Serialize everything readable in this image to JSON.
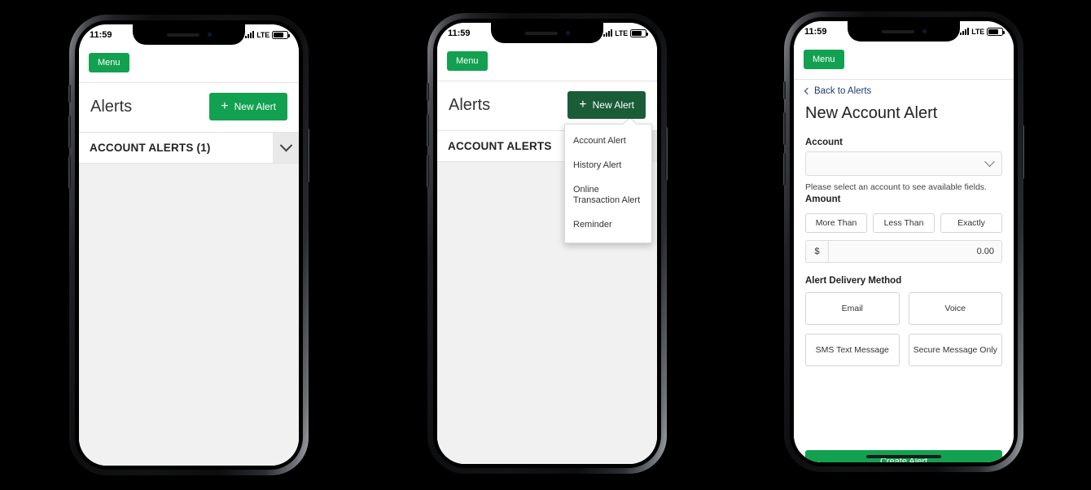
{
  "theme": {
    "page_background": "#000000",
    "brand_green": "#12a150",
    "brand_green_active": "#1a5c38",
    "link_navy": "#1f3a6e",
    "screen_gray": "#f1f1f1"
  },
  "status_bar": {
    "time": "11:59",
    "network": "LTE",
    "signal_icon": "signal-bars-icon",
    "battery_icon": "battery-icon"
  },
  "phones": [
    {
      "id": "phone-1",
      "name": "alerts-list-screen",
      "menu_label": "Menu",
      "page_title": "Alerts",
      "new_alert_label": "New Alert",
      "new_alert_state": "default",
      "section_title": "ACCOUNT ALERTS (1)",
      "collapse_icon": "chevron-down-icon",
      "dropdown_open": false,
      "home_indicator": false
    },
    {
      "id": "phone-2",
      "name": "alerts-list-with-dropdown-screen",
      "menu_label": "Menu",
      "page_title": "Alerts",
      "new_alert_label": "New Alert",
      "new_alert_state": "active",
      "section_title": "ACCOUNT ALERTS",
      "collapse_icon": "chevron-down-icon",
      "dropdown_open": true,
      "dropdown_items": [
        "Account Alert",
        "History Alert",
        "Online Transaction Alert",
        "Reminder"
      ],
      "home_indicator": false
    },
    {
      "id": "phone-3",
      "name": "new-account-alert-form-screen",
      "menu_label": "Menu",
      "back_link": "Back to Alerts",
      "back_icon": "chevron-left-icon",
      "form_title": "New Account Alert",
      "account_label": "Account",
      "account_value": "",
      "account_icon": "chevron-down-icon",
      "hint": "Please select an account to see available fields.",
      "amount_label": "Amount",
      "comparison_options": [
        "More Than",
        "Less Than",
        "Exactly"
      ],
      "currency_symbol": "$",
      "amount_value": "0.00",
      "delivery_label": "Alert Delivery Method",
      "delivery_options": [
        "Email",
        "Voice",
        "SMS Text Message",
        "Secure Message Only"
      ],
      "submit_label": "Create Alert",
      "home_indicator": true
    }
  ]
}
